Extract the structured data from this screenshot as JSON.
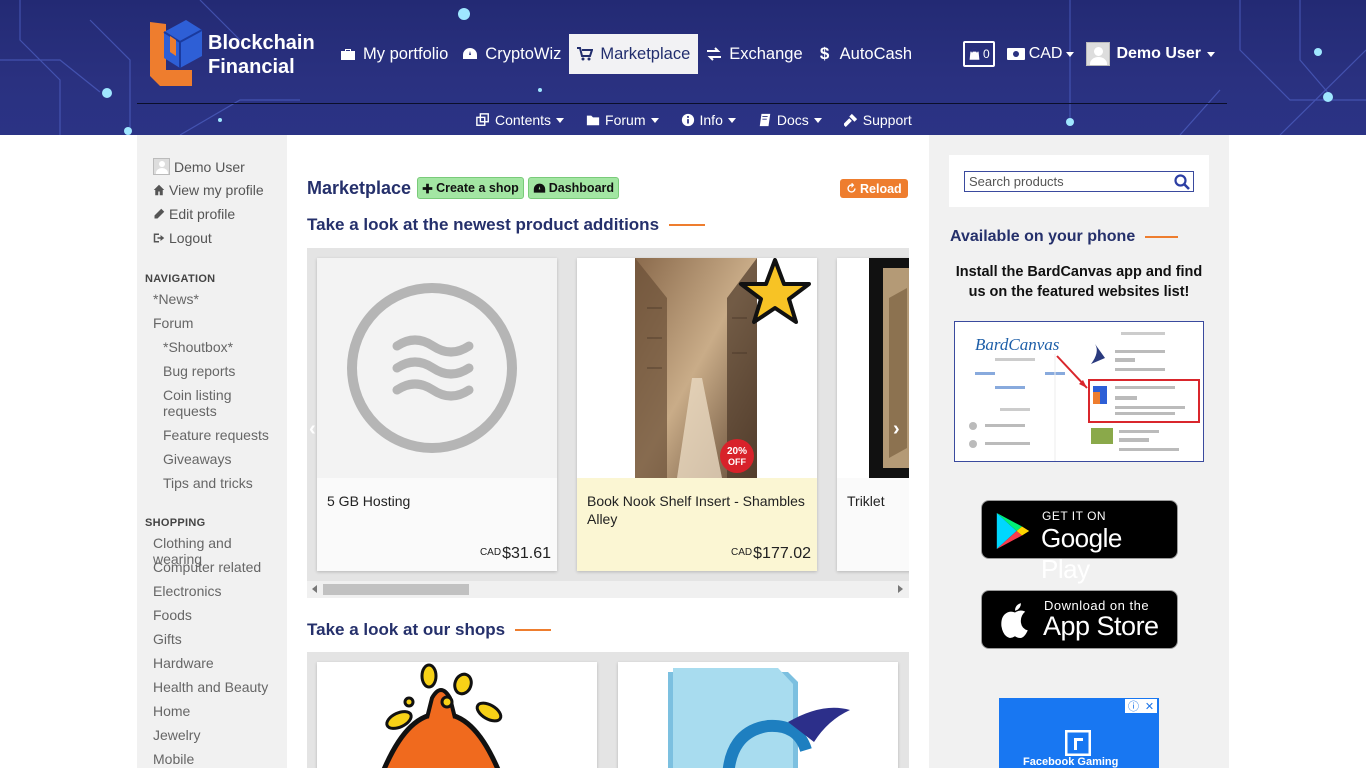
{
  "header": {
    "brand": {
      "line1": "Blockchain",
      "line2": "Financial"
    },
    "nav": [
      {
        "label": "My portfolio",
        "icon": "briefcase-icon"
      },
      {
        "label": "CryptoWiz",
        "icon": "dashboard-icon"
      },
      {
        "label": "Marketplace",
        "icon": "cart-icon",
        "active": true
      },
      {
        "label": "Exchange",
        "icon": "exchange-icon"
      },
      {
        "label": "AutoCash",
        "icon": "dollar-icon"
      }
    ],
    "cart_count": "0",
    "currency": "CAD",
    "user_name": "Demo User"
  },
  "subnav": [
    {
      "label": "Contents",
      "icon": "clone-icon"
    },
    {
      "label": "Forum",
      "icon": "folder-icon"
    },
    {
      "label": "Info",
      "icon": "info-icon"
    },
    {
      "label": "Docs",
      "icon": "book-icon"
    },
    {
      "label": "Support",
      "icon": "gavel-icon"
    }
  ],
  "left_sidebar": {
    "user": "Demo User",
    "account_links": [
      "View my profile",
      "Edit profile",
      "Logout"
    ],
    "navigation_heading": "NAVIGATION",
    "navigation": {
      "news": "*News*",
      "forum": "Forum",
      "forum_children": [
        "*Shoutbox*",
        "Bug reports",
        "Coin listing requests",
        "Feature requests",
        "Giveaways",
        "Tips and tricks"
      ]
    },
    "shopping_heading": "SHOPPING",
    "shopping": [
      "Clothing and wearing",
      "Computer related",
      "Electronics",
      "Foods",
      "Gifts",
      "Hardware",
      "Health and Beauty",
      "Home",
      "Jewelry",
      "Mobile"
    ]
  },
  "main": {
    "title": "Marketplace",
    "create_shop": "Create a shop",
    "dashboard": "Dashboard",
    "reload": "Reload",
    "newest_heading": "Take a look at the newest product additions",
    "shops_heading": "Take a look at our shops",
    "products": [
      {
        "name": "5 GB Hosting",
        "currency": "CAD",
        "price": "$31.61"
      },
      {
        "name": "Book Nook Shelf Insert - Shambles Alley",
        "currency": "CAD",
        "price": "$177.02",
        "badge": "20% OFF",
        "featured": true
      },
      {
        "name": "Triklet",
        "currency": "",
        "price": ""
      }
    ]
  },
  "right_sidebar": {
    "search_placeholder": "Search products",
    "phone_heading": "Available on your phone",
    "phone_text": "Install the BardCanvas app and find us on the featured websites list!",
    "google_play": {
      "small": "GET IT ON",
      "big": "Google Play"
    },
    "app_store": {
      "small": "Download on the",
      "big": "App Store"
    },
    "ad_text": "Facebook Gaming"
  },
  "colors": {
    "header_bg": "#2a3180",
    "accent": "#ee7d2e",
    "title": "#25306b",
    "green_btn": "#a3e6a3"
  }
}
